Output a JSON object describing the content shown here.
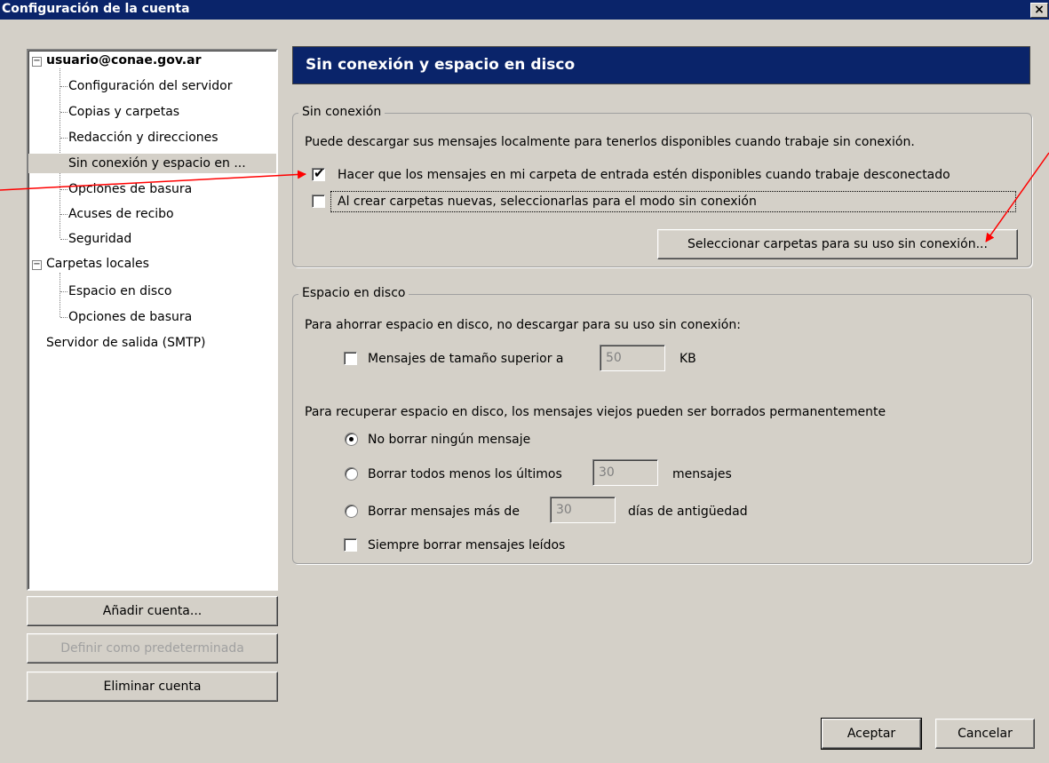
{
  "window": {
    "title": "Configuración de la cuenta",
    "close_glyph": "×"
  },
  "tree": {
    "account1": "usuario@conae.gov.ar",
    "account1_items": [
      "Configuración del servidor",
      "Copias y carpetas",
      "Redacción y direcciones",
      "Sin conexión y espacio en ...",
      "Opciones de basura",
      "Acuses de recibo",
      "Seguridad"
    ],
    "account2": "Carpetas locales",
    "account2_items": [
      "Espacio en disco",
      "Opciones de basura"
    ],
    "smtp": "Servidor de salida (SMTP)",
    "expander_glyph": "−"
  },
  "left_buttons": {
    "add_account": "Añadir cuenta...",
    "set_default": "Definir como predeterminada",
    "remove_account": "Eliminar cuenta"
  },
  "panel": {
    "title": "Sin conexión y espacio en disco",
    "offline": {
      "legend": "Sin conexión",
      "description": "Puede descargar sus mensajes localmente para tenerlos disponibles cuando trabaje sin conexión.",
      "inbox_available_label": "Hacer que los mensajes en mi carpeta de entrada estén disponibles cuando trabaje desconectado",
      "inbox_available_checked": true,
      "new_folders_label": "Al crear carpetas nuevas, seleccionarlas para el modo sin conexión",
      "new_folders_checked": false,
      "select_folders_button": "Seleccionar carpetas para su uso sin conexión..."
    },
    "disk": {
      "legend": "Espacio en disco",
      "save_space_text": "Para ahorrar espacio en disco, no descargar para su uso sin conexión:",
      "size_limit_label": "Mensajes de tamaño superior a",
      "size_limit_checked": false,
      "size_limit_value": "50",
      "size_limit_unit": "KB",
      "recover_text": "Para recuperar espacio en disco, los mensajes viejos pueden ser borrados permanentemente",
      "options": {
        "keep_all": "No borrar ningún mensaje",
        "keep_last_prefix": "Borrar todos menos los últimos",
        "keep_last_value": "30",
        "keep_last_suffix": "mensajes",
        "older_than_prefix": "Borrar mensajes más de",
        "older_than_value": "30",
        "older_than_suffix": "días de antigüedad"
      },
      "selected_option": "keep_all",
      "delete_read_label": "Siempre borrar mensajes leídos",
      "delete_read_checked": false
    }
  },
  "footer": {
    "ok": "Aceptar",
    "cancel": "Cancelar"
  },
  "colors": {
    "titlebar": "#0a246a",
    "dialog_bg": "#d4d0c8",
    "annotation_arrow": "#ff0000"
  }
}
